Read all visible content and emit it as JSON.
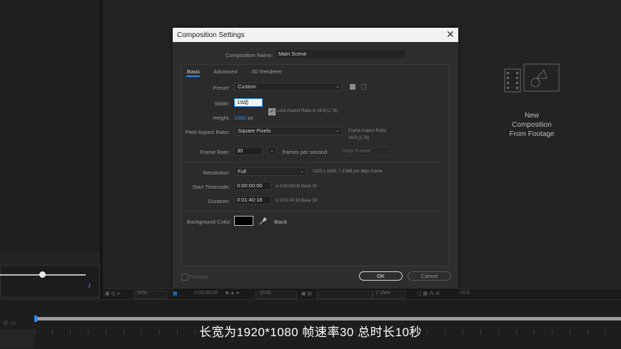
{
  "dialog": {
    "title": "Composition Settings",
    "close": "✕",
    "composition_name_label": "Composition Name:",
    "composition_name": "Main Scene",
    "tabs": [
      "Basic",
      "Advanced",
      "3D Renderer"
    ],
    "preset_label": "Preset:",
    "preset": "Custom",
    "width_label": "Width:",
    "width_value": "19动",
    "height_label": "Height:",
    "height_value": "1080",
    "height_unit": "px",
    "lock_aspect": "Lock Aspect Ratio to 16:9 (1.78)",
    "lock_checked": true,
    "par_label": "Pixel Aspect Ratio:",
    "par_value": "Square Pixels",
    "frame_aspect_label": "Frame Aspect Ratio:",
    "frame_aspect_value": "16:9 (1.78)",
    "frame_rate_label": "Frame Rate:",
    "frame_rate": "30",
    "frame_rate_unit": "frames per second",
    "drop_frame": "Drop Frame",
    "resolution_label": "Resolution:",
    "resolution": "Full",
    "resolution_info": "1920 x 1080, 7.9 MB per 8bpc frame",
    "start_timecode_label": "Start Timecode:",
    "start_timecode": "0:00:00:00",
    "start_timecode_info": "is 0:00:00:00  Base 30",
    "duration_label": "Duration:",
    "duration": "0:01:40:18",
    "duration_info": "is 0:01:40:18  Base 30",
    "bg_color_label": "Background Color:",
    "bg_color_name": "Black",
    "preview_label": "Preview",
    "ok": "OK",
    "cancel": "Cancel"
  },
  "new_comp_from_footage": "New\nComposition\nFrom Footage",
  "viewer_toolbar": {
    "zoom": "50%",
    "timecode": "0:00:00:00",
    "resolution": "(Full)",
    "view": "1 View",
    "exposure": "+0.0"
  },
  "subtitle": "长宽为1920*1080  帧速率30  总时长10秒",
  "colors": {
    "accent": "#2d8ceb",
    "dialog_bg": "#2e2e2e",
    "titlebar": "#f2f2f2"
  }
}
